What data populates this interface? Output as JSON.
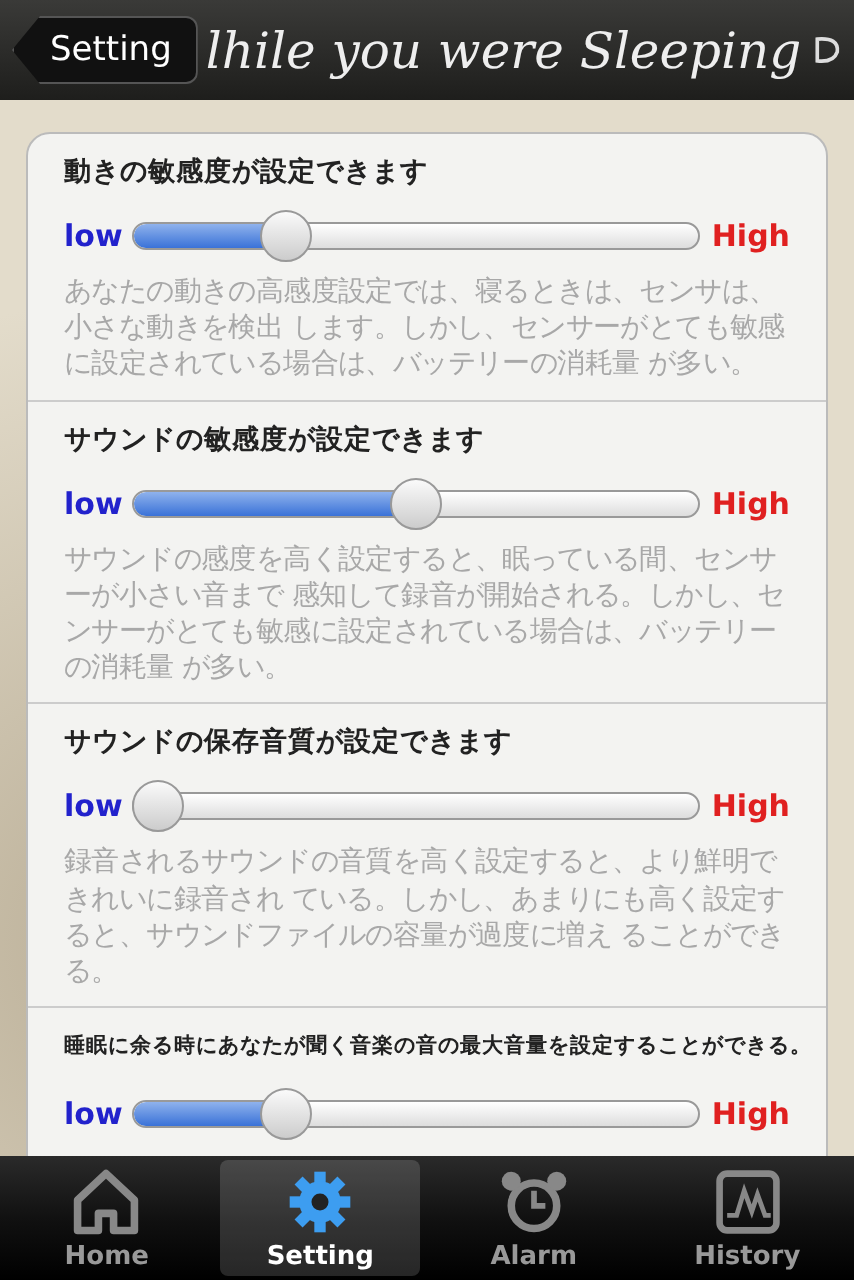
{
  "nav_bar": {
    "back_button": "Setting",
    "title": "lhile you were Sleeping"
  },
  "settings": [
    {
      "kind": "normal",
      "heading": "動きの敏感度が設定できます",
      "low_label": "low",
      "high_label": "High",
      "level": 0.25,
      "description": "あなたの動きの高感度設定では、寝るときは、センサは、小さな動きを検出 します。しかし、センサーがとても敏感に設定されている場合は、バッテリーの消耗量 が多い。"
    },
    {
      "kind": "normal",
      "heading": "サウンドの敏感度が設定できます",
      "low_label": "low",
      "high_label": "High",
      "level": 0.5,
      "description": "サウンドの感度を高く設定すると、眠っている間、センサーが小さい音まで 感知して録音が開始される。しかし、センサーがとても敏感に設定されている場合は、バッテリーの消耗量 が多い。"
    },
    {
      "kind": "normal",
      "heading": "サウンドの保存音質が設定できます",
      "low_label": "low",
      "high_label": "High",
      "level": 0,
      "description": "録音されるサウンドの音質を高く設定すると、より鮮明できれいに録音され ている。しかし、あまりにも高く設定すると、サウンドファイルの容量が過度に増え ることができる。"
    },
    {
      "kind": "compact",
      "heading": "睡眠に余る時にあなたが聞く音楽の音の最大音量を設定することができる。",
      "low_label": "low",
      "high_label": "High",
      "level": 0.25
    }
  ],
  "tab_bar": [
    {
      "label": "Home",
      "selected": false
    },
    {
      "label": "Setting",
      "selected": true
    },
    {
      "label": "Alarm",
      "selected": false
    },
    {
      "label": "History",
      "selected": false
    }
  ]
}
